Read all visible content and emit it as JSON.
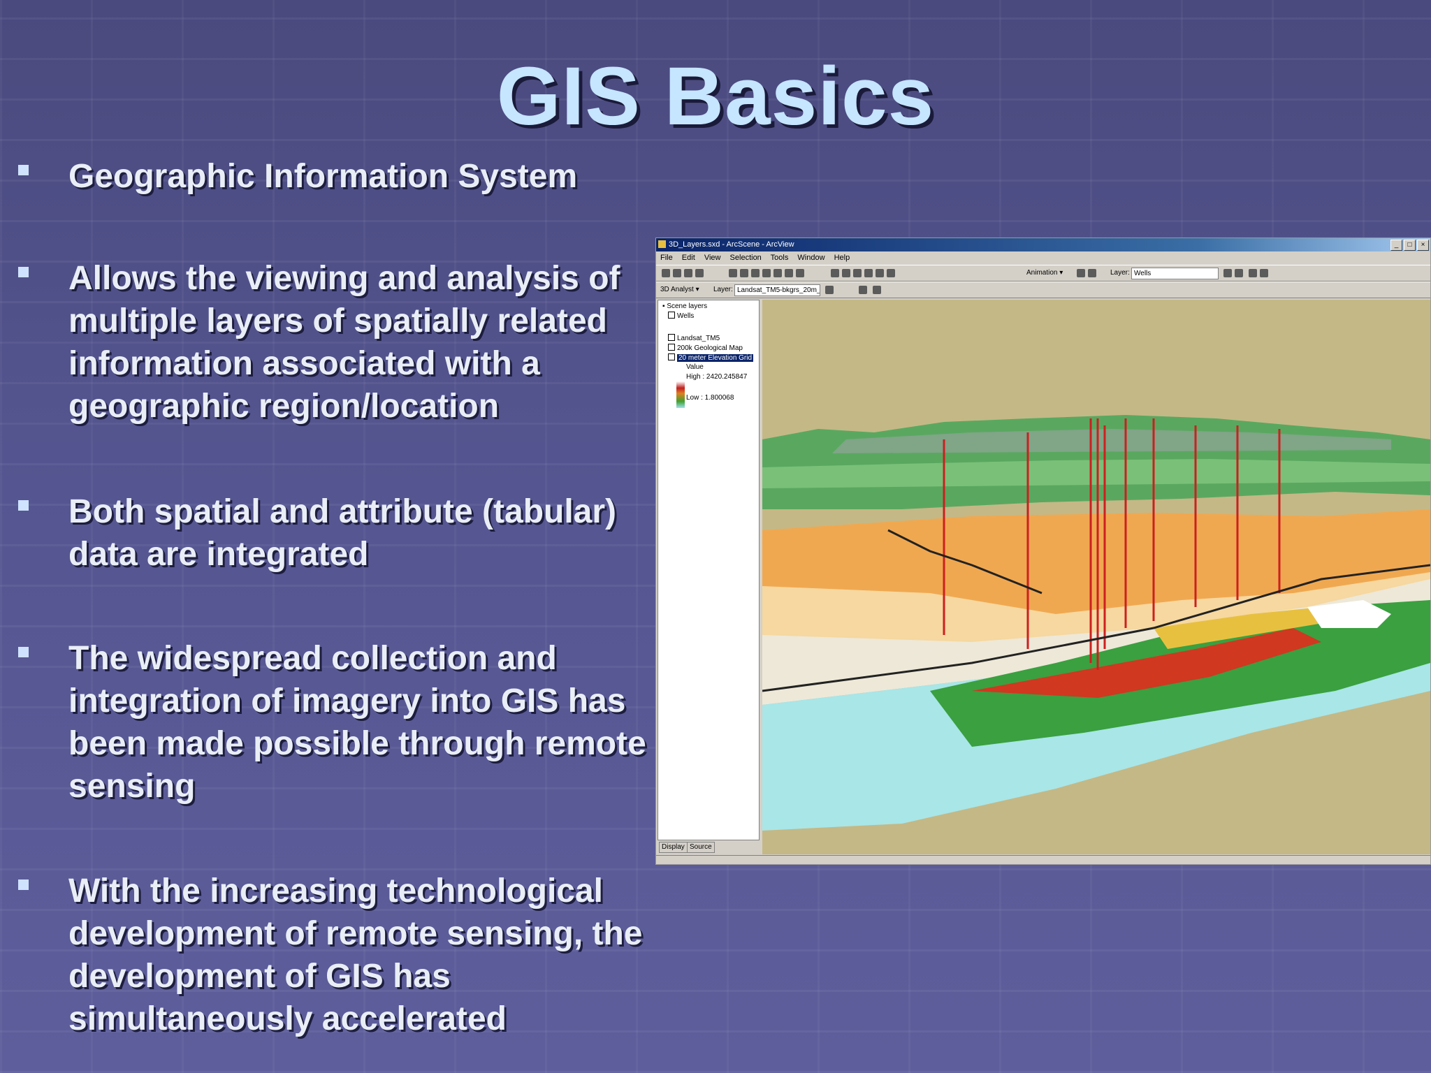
{
  "slide": {
    "title": "GIS Basics",
    "bullets": [
      {
        "text": "Geographic Information System"
      },
      {
        "text": "Allows the viewing and analysis of multiple layers of spatially related information associated with a geographic region/location"
      },
      {
        "text": "Both spatial and attribute (tabular) data are integrated"
      },
      {
        "text": "The widespread collection and integration of imagery into GIS has been made possible through remote sensing"
      },
      {
        "text": "With the increasing technological development of remote sensing, the development of GIS has simultaneously accelerated"
      }
    ]
  },
  "screenshot": {
    "window_title": "3D_Layers.sxd - ArcScene - ArcView",
    "window_buttons": [
      "_",
      "□",
      "×"
    ],
    "menu": [
      "File",
      "Edit",
      "View",
      "Selection",
      "Tools",
      "Window",
      "Help"
    ],
    "toolbar": {
      "animation_label": "Animation ▾",
      "layer_label": "Layer:",
      "layer_value": "Wells",
      "analysis_label": "3D Analyst ▾",
      "layer2_label": "Layer:",
      "layer2_value": "Landsat_TM5-bkgrs_20m_"
    },
    "toc": {
      "root": "Scene layers",
      "layers": [
        "Wells",
        "Landsat_TM5",
        "200k Geological Map",
        "20 meter Elevation Grid"
      ],
      "legend_title": "Value",
      "high": "High : 2420.245847",
      "low": "Low : 1.800068"
    },
    "tabs": [
      "Display",
      "Source"
    ],
    "colors": {
      "sky": "#c4b886",
      "water": "#a8e6e8",
      "geology": "#f0a850",
      "imagery": "#5aa860",
      "wells": "#cc2020"
    }
  }
}
